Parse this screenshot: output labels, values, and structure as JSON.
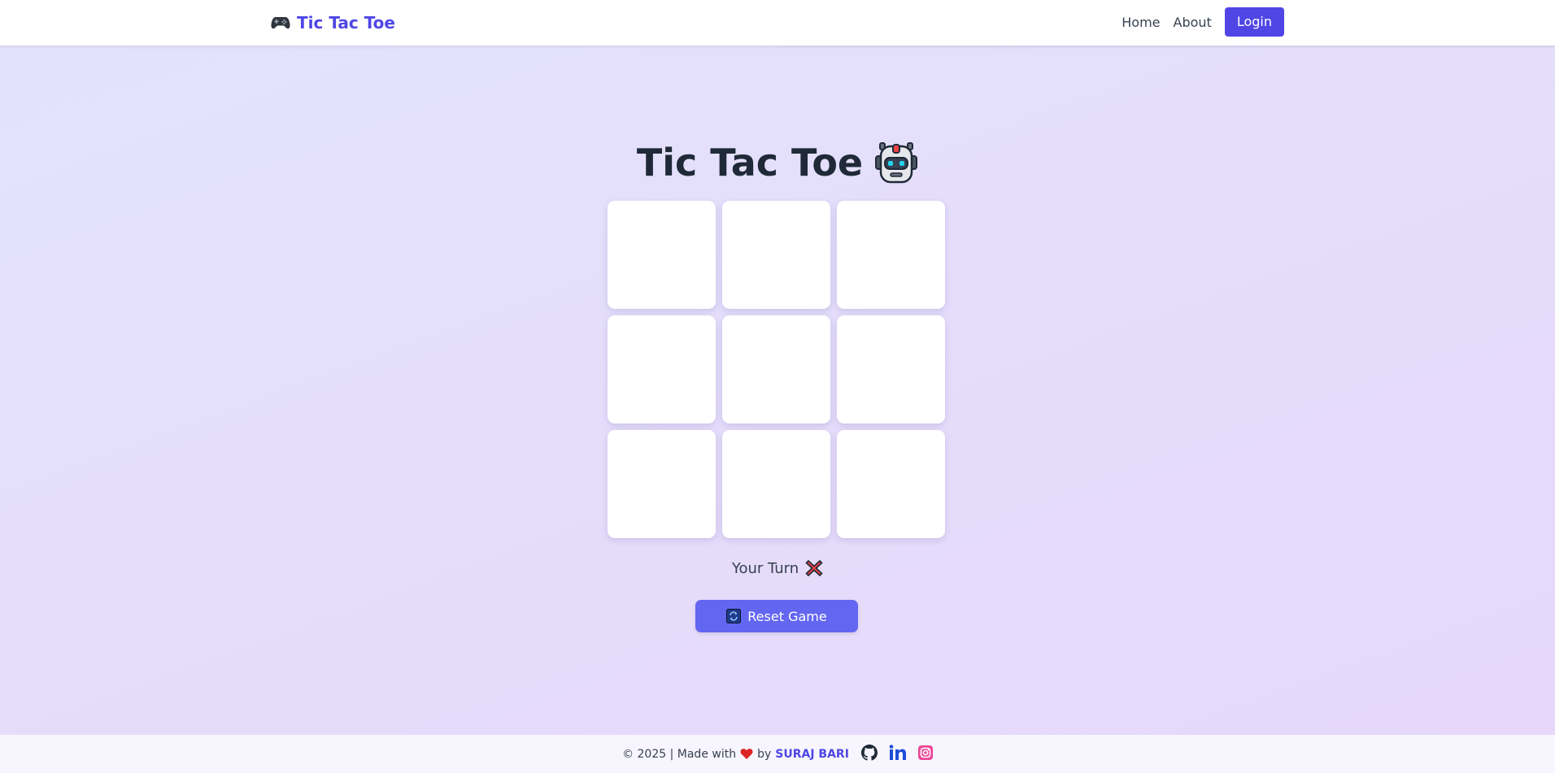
{
  "navbar": {
    "brand_icon": "gamepad-icon",
    "brand_text": "Tic Tac Toe",
    "links": [
      {
        "label": "Home"
      },
      {
        "label": "About"
      }
    ],
    "login_label": "Login"
  },
  "main": {
    "title": "Tic Tac Toe",
    "title_icon": "robot-icon",
    "board": {
      "rows": 3,
      "cols": 3,
      "cells": [
        "",
        "",
        "",
        "",
        "",
        "",
        "",
        "",
        ""
      ]
    },
    "status_text": "Your Turn",
    "status_icon": "x-mark-icon",
    "reset_label": "Reset Game",
    "reset_icon": "refresh-icon"
  },
  "footer": {
    "prefix": "© 2025 | Made with",
    "heart_icon": "heart-icon",
    "by_text": "by",
    "author": "SURAJ BARI",
    "social": [
      "github-icon",
      "linkedin-icon",
      "instagram-icon"
    ]
  },
  "colors": {
    "accent": "#4f46e5",
    "reset_button": "#6366f1",
    "title_text": "#1f2937",
    "background_start": "#e3e3fd",
    "background_end": "#e7d7f9"
  }
}
